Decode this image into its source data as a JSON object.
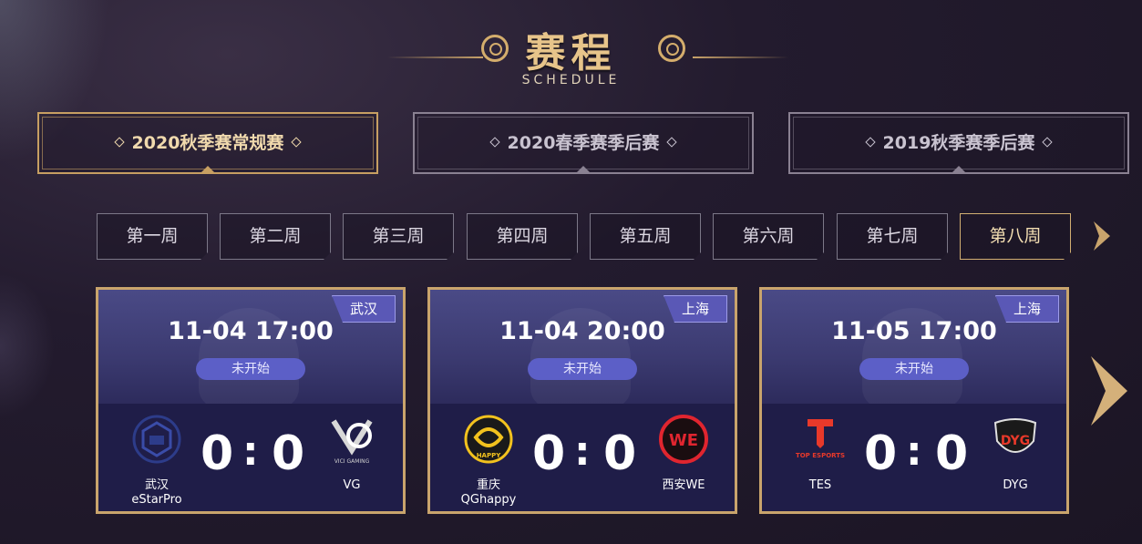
{
  "header": {
    "title": "赛程",
    "subtitle": "SCHEDULE"
  },
  "seasons": [
    {
      "label": "2020秋季赛常规赛",
      "active": true
    },
    {
      "label": "2020春季赛季后赛",
      "active": false
    },
    {
      "label": "2019秋季赛季后赛",
      "active": false
    }
  ],
  "weeks": [
    {
      "label": "第一周"
    },
    {
      "label": "第二周"
    },
    {
      "label": "第三周"
    },
    {
      "label": "第四周"
    },
    {
      "label": "第五周"
    },
    {
      "label": "第六周"
    },
    {
      "label": "第七周"
    },
    {
      "label": "第八周"
    }
  ],
  "matches": [
    {
      "city": "武汉",
      "datetime": "11-04 17:00",
      "status": "未开始",
      "home": {
        "name_line1": "武汉",
        "name_line2": "eStarPro",
        "score": "0",
        "logo": "estarpro-logo"
      },
      "away": {
        "name_line1": "VG",
        "name_line2": "",
        "score": "0",
        "logo": "vg-logo",
        "logo_text": "VICI GAMING"
      }
    },
    {
      "city": "上海",
      "datetime": "11-04 20:00",
      "status": "未开始",
      "home": {
        "name_line1": "重庆",
        "name_line2": "QGhappy",
        "score": "0",
        "logo": "qghappy-logo",
        "logo_text": "HAPPY"
      },
      "away": {
        "name_line1": "西安WE",
        "name_line2": "",
        "score": "0",
        "logo": "we-logo",
        "logo_text": "WE"
      }
    },
    {
      "city": "上海",
      "datetime": "11-05 17:00",
      "status": "未开始",
      "home": {
        "name_line1": "TES",
        "name_line2": "",
        "score": "0",
        "logo": "tes-logo",
        "logo_text": "TOP ESPORTS"
      },
      "away": {
        "name_line1": "DYG",
        "name_line2": "",
        "score": "0",
        "logo": "dyg-logo",
        "logo_text": "DYG"
      }
    }
  ],
  "colors": {
    "gold": "#c9a46c",
    "accent_blue": "#5c5fc7",
    "card_bg": "#232147"
  },
  "icons": {
    "week_next": "chevron-right-icon",
    "matches_next": "chevron-right-large-icon"
  }
}
